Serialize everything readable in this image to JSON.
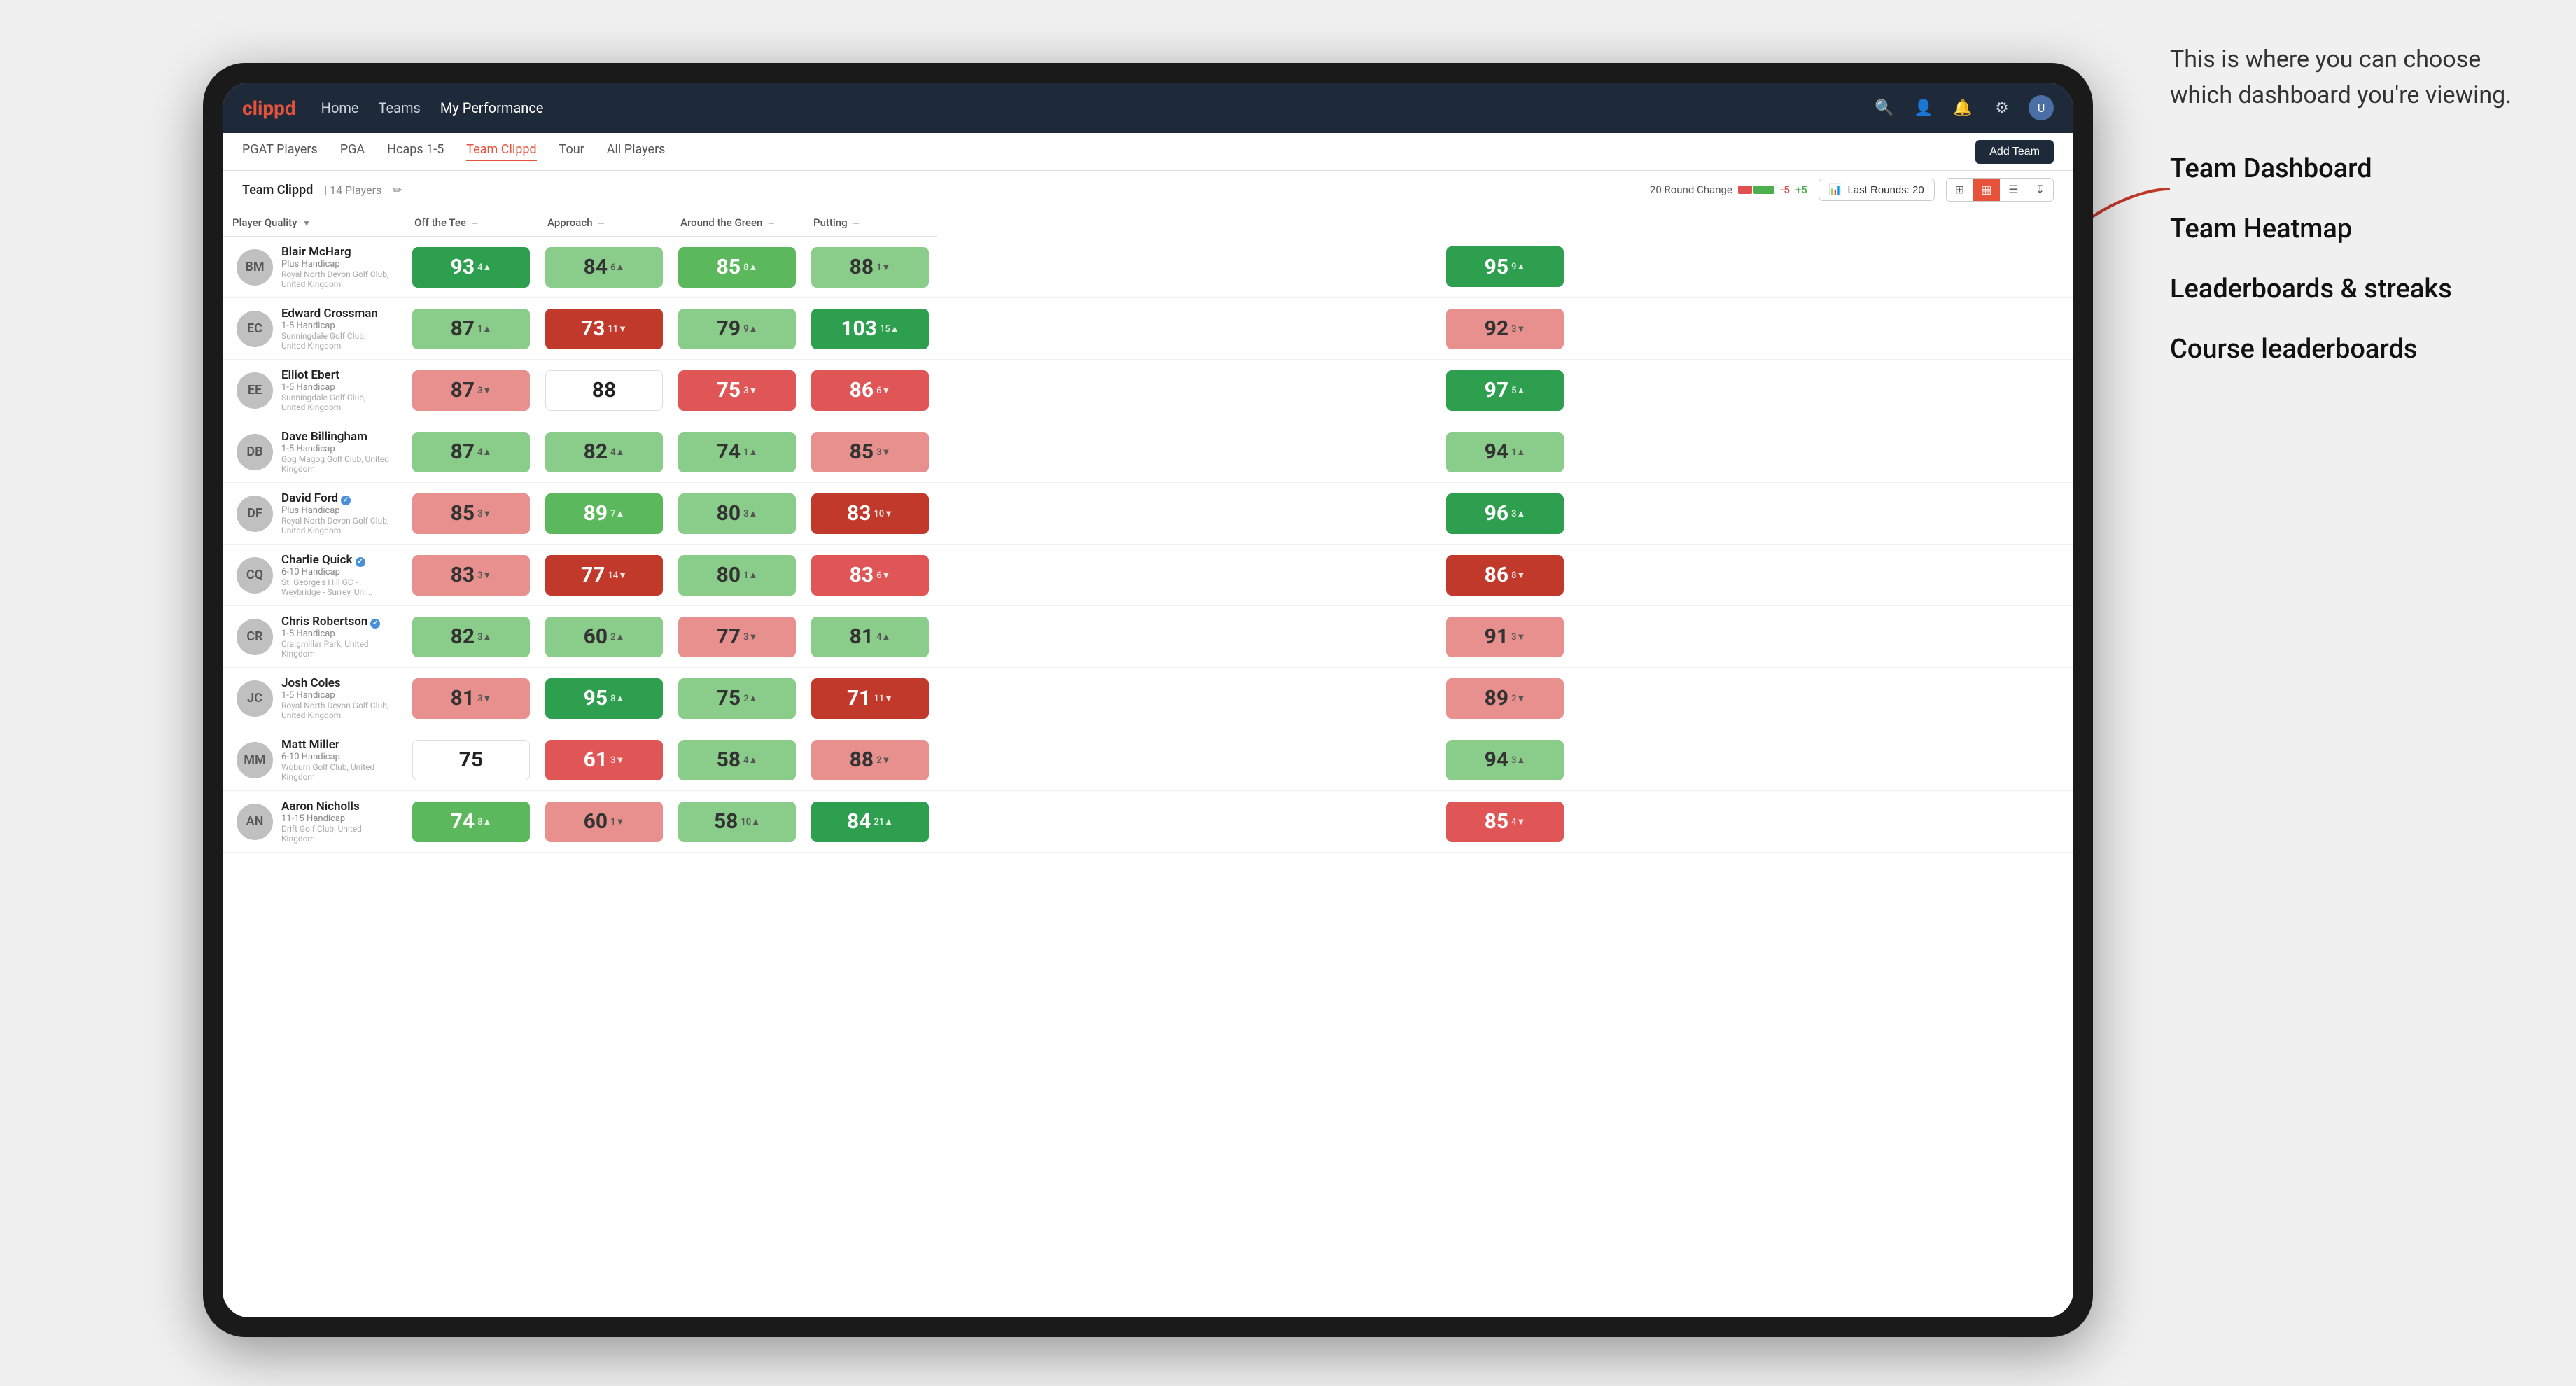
{
  "annotation": {
    "intro_text": "This is where you can choose which dashboard you're viewing.",
    "dashboard_options": [
      "Team Dashboard",
      "Team Heatmap",
      "Leaderboards & streaks",
      "Course leaderboards"
    ]
  },
  "navbar": {
    "logo": "clippd",
    "nav_items": [
      "Home",
      "Teams",
      "My Performance"
    ],
    "active_nav": "My Performance"
  },
  "subnav": {
    "items": [
      "PGAT Players",
      "PGA",
      "Hcaps 1-5",
      "Team Clippd",
      "Tour",
      "All Players"
    ],
    "active_item": "Team Clippd",
    "add_team_label": "Add Team"
  },
  "team_header": {
    "team_name": "Team Clippd",
    "separator": "|",
    "player_count": "14 Players",
    "round_change_label": "20 Round Change",
    "score_neg": "-5",
    "score_pos": "+5",
    "last_rounds_label": "Last Rounds:",
    "last_rounds_value": "20"
  },
  "table": {
    "columns": [
      {
        "id": "player",
        "label": "Player Quality",
        "sortable": true
      },
      {
        "id": "off_tee",
        "label": "Off the Tee",
        "sortable": false
      },
      {
        "id": "approach",
        "label": "Approach",
        "sortable": false
      },
      {
        "id": "around_green",
        "label": "Around the Green",
        "sortable": false
      },
      {
        "id": "putting",
        "label": "Putting",
        "sortable": false
      }
    ],
    "rows": [
      {
        "name": "Blair McHarg",
        "handicap": "Plus Handicap",
        "club": "Royal North Devon Golf Club, United Kingdom",
        "initials": "BM",
        "player_quality": {
          "value": "93",
          "change": "4",
          "direction": "up",
          "bg": "green-dark"
        },
        "off_tee": {
          "value": "84",
          "change": "6",
          "direction": "up",
          "bg": "green-light"
        },
        "approach": {
          "value": "85",
          "change": "8",
          "direction": "up",
          "bg": "green-mid"
        },
        "around_green": {
          "value": "88",
          "change": "1",
          "direction": "down",
          "bg": "green-light"
        },
        "putting": {
          "value": "95",
          "change": "9",
          "direction": "up",
          "bg": "green-dark"
        }
      },
      {
        "name": "Edward Crossman",
        "handicap": "1-5 Handicap",
        "club": "Sunningdale Golf Club, United Kingdom",
        "initials": "EC",
        "player_quality": {
          "value": "87",
          "change": "1",
          "direction": "up",
          "bg": "green-light"
        },
        "off_tee": {
          "value": "73",
          "change": "11",
          "direction": "down",
          "bg": "red-dark"
        },
        "approach": {
          "value": "79",
          "change": "9",
          "direction": "up",
          "bg": "green-light"
        },
        "around_green": {
          "value": "103",
          "change": "15",
          "direction": "up",
          "bg": "green-dark"
        },
        "putting": {
          "value": "92",
          "change": "3",
          "direction": "down",
          "bg": "red-light"
        }
      },
      {
        "name": "Elliot Ebert",
        "handicap": "1-5 Handicap",
        "club": "Sunningdale Golf Club, United Kingdom",
        "initials": "EE",
        "player_quality": {
          "value": "87",
          "change": "3",
          "direction": "down",
          "bg": "red-light"
        },
        "off_tee": {
          "value": "88",
          "change": "",
          "direction": "none",
          "bg": "white"
        },
        "approach": {
          "value": "75",
          "change": "3",
          "direction": "down",
          "bg": "red-mid"
        },
        "around_green": {
          "value": "86",
          "change": "6",
          "direction": "down",
          "bg": "red-mid"
        },
        "putting": {
          "value": "97",
          "change": "5",
          "direction": "up",
          "bg": "green-dark"
        }
      },
      {
        "name": "Dave Billingham",
        "handicap": "1-5 Handicap",
        "club": "Gog Magog Golf Club, United Kingdom",
        "initials": "DB",
        "player_quality": {
          "value": "87",
          "change": "4",
          "direction": "up",
          "bg": "green-light"
        },
        "off_tee": {
          "value": "82",
          "change": "4",
          "direction": "up",
          "bg": "green-light"
        },
        "approach": {
          "value": "74",
          "change": "1",
          "direction": "up",
          "bg": "green-light"
        },
        "around_green": {
          "value": "85",
          "change": "3",
          "direction": "down",
          "bg": "red-light"
        },
        "putting": {
          "value": "94",
          "change": "1",
          "direction": "up",
          "bg": "green-light"
        }
      },
      {
        "name": "David Ford",
        "handicap": "Plus Handicap",
        "club": "Royal North Devon Golf Club, United Kingdom",
        "initials": "DF",
        "verified": true,
        "player_quality": {
          "value": "85",
          "change": "3",
          "direction": "down",
          "bg": "red-light"
        },
        "off_tee": {
          "value": "89",
          "change": "7",
          "direction": "up",
          "bg": "green-mid"
        },
        "approach": {
          "value": "80",
          "change": "3",
          "direction": "up",
          "bg": "green-light"
        },
        "around_green": {
          "value": "83",
          "change": "10",
          "direction": "down",
          "bg": "red-dark"
        },
        "putting": {
          "value": "96",
          "change": "3",
          "direction": "up",
          "bg": "green-dark"
        }
      },
      {
        "name": "Charlie Quick",
        "handicap": "6-10 Handicap",
        "club": "St. George's Hill GC - Weybridge - Surrey, Uni...",
        "initials": "CQ",
        "verified": true,
        "player_quality": {
          "value": "83",
          "change": "3",
          "direction": "down",
          "bg": "red-light"
        },
        "off_tee": {
          "value": "77",
          "change": "14",
          "direction": "down",
          "bg": "red-dark"
        },
        "approach": {
          "value": "80",
          "change": "1",
          "direction": "up",
          "bg": "green-light"
        },
        "around_green": {
          "value": "83",
          "change": "6",
          "direction": "down",
          "bg": "red-mid"
        },
        "putting": {
          "value": "86",
          "change": "8",
          "direction": "down",
          "bg": "red-dark"
        }
      },
      {
        "name": "Chris Robertson",
        "handicap": "1-5 Handicap",
        "club": "Craigmillar Park, United Kingdom",
        "initials": "CR",
        "verified": true,
        "player_quality": {
          "value": "82",
          "change": "3",
          "direction": "up",
          "bg": "green-light"
        },
        "off_tee": {
          "value": "60",
          "change": "2",
          "direction": "up",
          "bg": "green-light"
        },
        "approach": {
          "value": "77",
          "change": "3",
          "direction": "down",
          "bg": "red-light"
        },
        "around_green": {
          "value": "81",
          "change": "4",
          "direction": "up",
          "bg": "green-light"
        },
        "putting": {
          "value": "91",
          "change": "3",
          "direction": "down",
          "bg": "red-light"
        }
      },
      {
        "name": "Josh Coles",
        "handicap": "1-5 Handicap",
        "club": "Royal North Devon Golf Club, United Kingdom",
        "initials": "JC",
        "player_quality": {
          "value": "81",
          "change": "3",
          "direction": "down",
          "bg": "red-light"
        },
        "off_tee": {
          "value": "95",
          "change": "8",
          "direction": "up",
          "bg": "green-dark"
        },
        "approach": {
          "value": "75",
          "change": "2",
          "direction": "up",
          "bg": "green-light"
        },
        "around_green": {
          "value": "71",
          "change": "11",
          "direction": "down",
          "bg": "red-dark"
        },
        "putting": {
          "value": "89",
          "change": "2",
          "direction": "down",
          "bg": "red-light"
        }
      },
      {
        "name": "Matt Miller",
        "handicap": "6-10 Handicap",
        "club": "Woburn Golf Club, United Kingdom",
        "initials": "MM",
        "player_quality": {
          "value": "75",
          "change": "",
          "direction": "none",
          "bg": "white"
        },
        "off_tee": {
          "value": "61",
          "change": "3",
          "direction": "down",
          "bg": "red-mid"
        },
        "approach": {
          "value": "58",
          "change": "4",
          "direction": "up",
          "bg": "green-light"
        },
        "around_green": {
          "value": "88",
          "change": "2",
          "direction": "down",
          "bg": "red-light"
        },
        "putting": {
          "value": "94",
          "change": "3",
          "direction": "up",
          "bg": "green-light"
        }
      },
      {
        "name": "Aaron Nicholls",
        "handicap": "11-15 Handicap",
        "club": "Drift Golf Club, United Kingdom",
        "initials": "AN",
        "player_quality": {
          "value": "74",
          "change": "8",
          "direction": "up",
          "bg": "green-mid"
        },
        "off_tee": {
          "value": "60",
          "change": "1",
          "direction": "down",
          "bg": "red-light"
        },
        "approach": {
          "value": "58",
          "change": "10",
          "direction": "up",
          "bg": "green-light"
        },
        "around_green": {
          "value": "84",
          "change": "21",
          "direction": "up",
          "bg": "green-dark"
        },
        "putting": {
          "value": "85",
          "change": "4",
          "direction": "down",
          "bg": "red-mid"
        }
      }
    ]
  },
  "colors": {
    "green_dark": "#2e9e4f",
    "green_mid": "#5cb85c",
    "green_light": "#8acc8a",
    "red_dark": "#c0392b",
    "red_mid": "#e05555",
    "red_light": "#e8908e",
    "white_bg": "#ffffff",
    "nav_bg": "#1e2a3a",
    "accent": "#e8523a"
  }
}
